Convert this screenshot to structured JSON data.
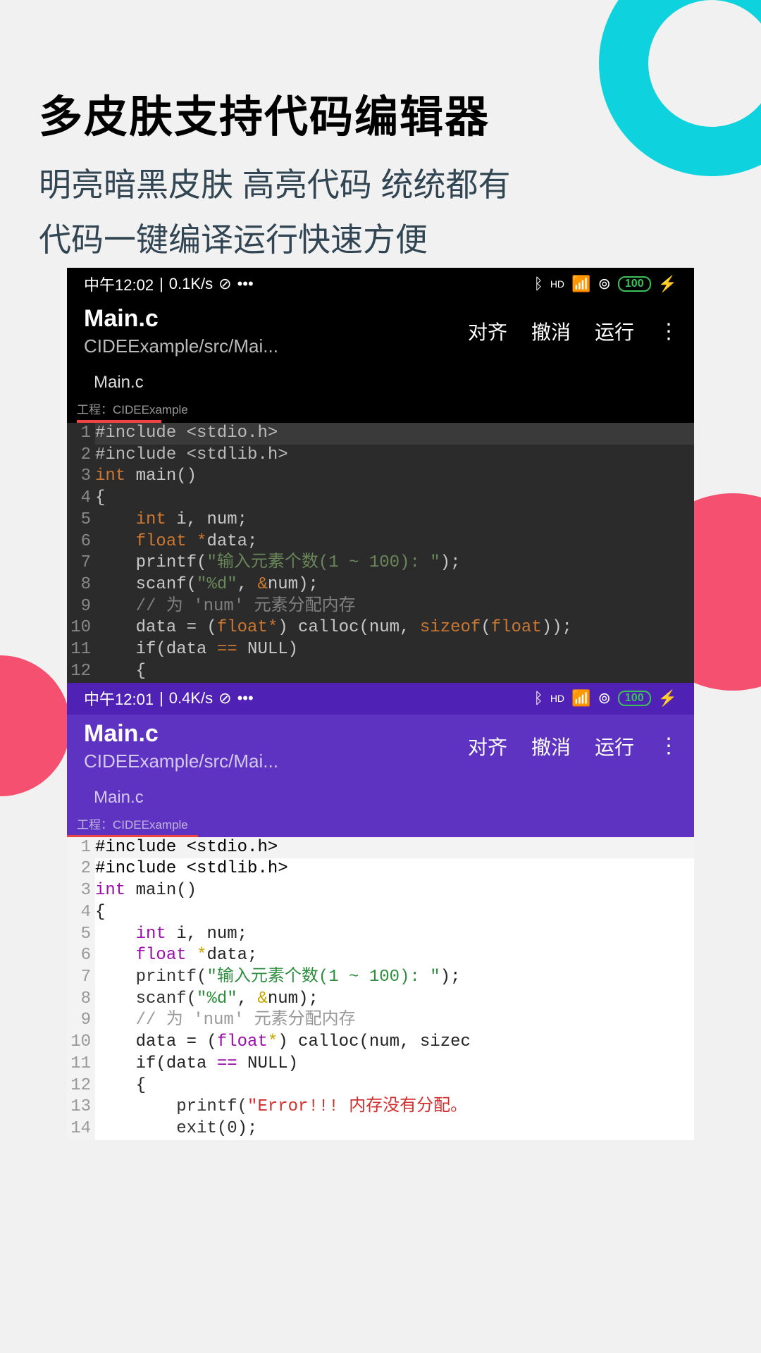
{
  "header": {
    "title": "多皮肤支持代码编辑器",
    "subtitle1": "明亮暗黑皮肤 高亮代码 统统都有",
    "subtitle2": "代码一键编译运行快速方便"
  },
  "dark": {
    "status": {
      "time": "中午12:02",
      "net": "0.1K/s",
      "battery": "100"
    },
    "title": "Main.c",
    "path": "CIDEExample/src/Mai...",
    "actions": {
      "align": "对齐",
      "undo": "撤消",
      "run": "运行"
    },
    "tab": "Main.c",
    "project": "工程：CIDEExample",
    "code": {
      "l1": {
        "pp": "#include ",
        "inc": "<stdio.h>"
      },
      "l2": {
        "pp": "#include ",
        "inc": "<stdlib.h>"
      },
      "l3": {
        "kw": "int",
        "rest": " main()"
      },
      "l4": "{",
      "l5": {
        "pad": "    ",
        "kw": "int",
        "rest": " i, num;"
      },
      "l6": {
        "pad": "    ",
        "kw": "float",
        "star": " *",
        "rest": "data;"
      },
      "l7": {
        "pad": "    ",
        "fn": "printf(",
        "str": "\"输入元素个数(1 ~ 100): \"",
        "rest": ");"
      },
      "l8": {
        "pad": "    ",
        "fn": "scanf(",
        "str": "\"%d\"",
        "mid": ", ",
        "amp": "&",
        "rest": "num);"
      },
      "l9": {
        "pad": "    ",
        "cm": "// 为 'num' 元素分配内存"
      },
      "l10": {
        "pad": "    ",
        "a": "data = (",
        "kw": "float",
        "star": "*",
        "b": ") calloc(num, ",
        "kw2": "sizeof",
        "c": "(",
        "kw3": "float",
        "d": "));"
      },
      "l11": {
        "pad": "    ",
        "a": "if(data ",
        "op": "==",
        "b": " NULL)"
      },
      "l12": {
        "pad": "    ",
        "a": "{"
      }
    }
  },
  "light": {
    "status": {
      "time": "中午12:01",
      "net": "0.4K/s",
      "battery": "100"
    },
    "title": "Main.c",
    "path": "CIDEExample/src/Mai...",
    "actions": {
      "align": "对齐",
      "undo": "撤消",
      "run": "运行"
    },
    "tab": "Main.c",
    "project": "工程：CIDEExample",
    "code": {
      "l1": {
        "pp": "#include ",
        "inc": "<stdio.h>"
      },
      "l2": {
        "pp": "#include ",
        "inc": "<stdlib.h>"
      },
      "l3": {
        "kw": "int",
        "rest": " main()"
      },
      "l4": "{",
      "l5": {
        "pad": "    ",
        "kw": "int",
        "rest": " i, num;"
      },
      "l6": {
        "pad": "    ",
        "kw": "float",
        "star": " *",
        "rest": "data;"
      },
      "l7": {
        "pad": "    ",
        "fn": "printf(",
        "str": "\"输入元素个数(1 ~ 100): \"",
        "rest": ");"
      },
      "l8": {
        "pad": "    ",
        "fn": "scanf(",
        "str": "\"%d\"",
        "mid": ", ",
        "amp": "&",
        "rest": "num);"
      },
      "l9": {
        "pad": "    ",
        "cm": "// 为 'num' 元素分配内存"
      },
      "l10": {
        "pad": "    ",
        "a": "data = (",
        "kw": "float",
        "star": "*",
        "b": ") calloc(num, sizec"
      },
      "l11": {
        "pad": "    ",
        "a": "if(data ",
        "op": "==",
        "b": " NULL)"
      },
      "l12": {
        "pad": "    ",
        "a": "{"
      },
      "l13": {
        "pad": "        ",
        "fn": "printf(",
        "str": "\"Error!!! 内存没有分配。"
      },
      "l14": {
        "pad": "        ",
        "fn": "exit(",
        "num": "0",
        "rest": ");"
      }
    }
  }
}
